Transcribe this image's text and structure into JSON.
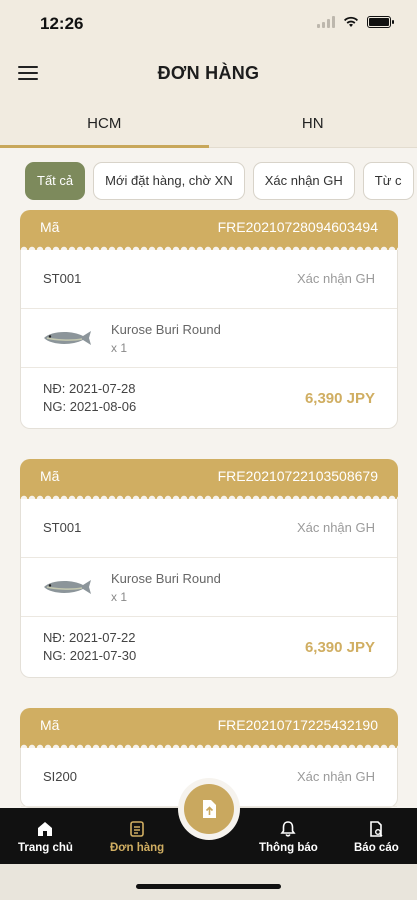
{
  "status_bar": {
    "time": "12:26"
  },
  "header": {
    "title": "ĐƠN HÀNG"
  },
  "tabs": [
    {
      "label": "HCM",
      "active": true
    },
    {
      "label": "HN",
      "active": false
    }
  ],
  "filters": [
    {
      "label": "Tất cả",
      "active": true
    },
    {
      "label": "Mới đặt hàng, chờ XN",
      "active": false
    },
    {
      "label": "Xác nhận GH",
      "active": false
    },
    {
      "label": "Từ c",
      "active": false
    }
  ],
  "orders": [
    {
      "code_label": "Mã",
      "code": "FRE20210728094603494",
      "store": "ST001",
      "status": "Xác nhận GH",
      "item_name": "Kurose Buri Round",
      "item_qty": "x 1",
      "order_date": "NĐ: 2021-07-28",
      "delivery_date": "NG: 2021-08-06",
      "price": "6,390 JPY"
    },
    {
      "code_label": "Mã",
      "code": "FRE20210722103508679",
      "store": "ST001",
      "status": "Xác nhận GH",
      "item_name": "Kurose Buri Round",
      "item_qty": "x 1",
      "order_date": "NĐ: 2021-07-22",
      "delivery_date": "NG: 2021-07-30",
      "price": "6,390 JPY"
    },
    {
      "code_label": "Mã",
      "code": "FRE20210717225432190",
      "store": "SI200",
      "status": "Xác nhận GH"
    }
  ],
  "bottom_nav": [
    {
      "label": "Trang chủ",
      "icon": "home-icon"
    },
    {
      "label": "Đơn hàng",
      "icon": "orders-icon",
      "active": true
    },
    {
      "label": "Thông báo",
      "icon": "bell-icon"
    },
    {
      "label": "Báo cáo",
      "icon": "report-icon"
    }
  ],
  "colors": {
    "accent": "#d0ae62",
    "chip_active": "#7d8a5c",
    "nav_bg": "#111111"
  }
}
